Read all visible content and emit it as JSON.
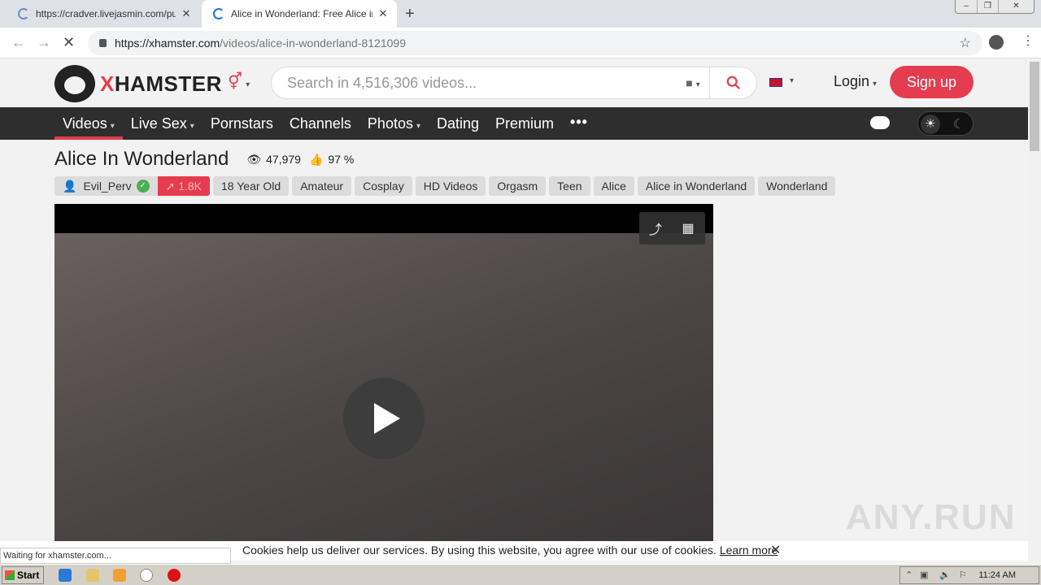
{
  "browser": {
    "tabs": [
      {
        "title": "https://cradver.livejasmin.com/pu/fs",
        "loading": true,
        "active": false
      },
      {
        "title": "Alice in Wonderland: Free Alice in Wo",
        "loading": true,
        "active": true
      }
    ],
    "new_tab_label": "+",
    "window_controls": {
      "minimize": "–",
      "restore": "❐",
      "close": "✕"
    },
    "url_host": "https://xhamster.com",
    "url_path": "/videos/alice-in-wonderland-8121099",
    "status_text": "Waiting for xhamster.com..."
  },
  "header": {
    "logo_x": "X",
    "logo_rest": "HAMSTER",
    "search_placeholder": "Search in 4,516,306 videos...",
    "login_label": "Login",
    "signup_label": "Sign up",
    "caret": "▾"
  },
  "nav": {
    "items": [
      {
        "label": "Videos",
        "dropdown": true,
        "selected": true
      },
      {
        "label": "Live Sex",
        "dropdown": true
      },
      {
        "label": "Pornstars"
      },
      {
        "label": "Channels"
      },
      {
        "label": "Photos",
        "dropdown": true
      },
      {
        "label": "Dating"
      },
      {
        "label": "Premium"
      }
    ],
    "more_label": "•••"
  },
  "video": {
    "title": "Alice In Wonderland",
    "views": "47,979",
    "rating": "97 %",
    "author": "Evil_Perv",
    "subscribers": "1.8K",
    "tags": [
      "18 Year Old",
      "Amateur",
      "Cosplay",
      "HD Videos",
      "Orgasm",
      "Teen",
      "Alice",
      "Alice in Wonderland",
      "Wonderland"
    ]
  },
  "cookie_bar": {
    "text": "Cookies help us deliver our services. By using this website, you agree with our use of cookies.",
    "link": "Learn more",
    "close": "✕"
  },
  "watermark": "ANY.RUN",
  "taskbar": {
    "start_label": "Start",
    "clock": "11:24 AM"
  },
  "colors": {
    "accent": "#e53d4f",
    "nav_bg": "#2e2e2e"
  }
}
